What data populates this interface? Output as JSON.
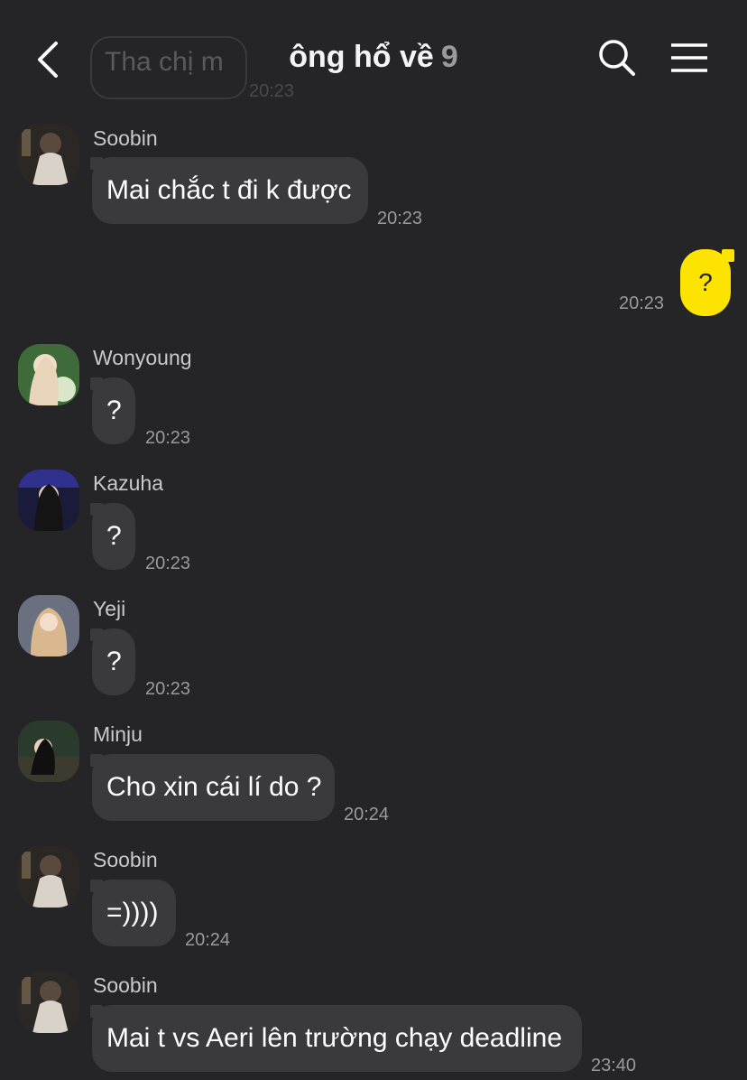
{
  "header": {
    "title": "ông hổ về",
    "count": "9",
    "icons": {
      "back": "chevron-left-icon",
      "search": "search-icon",
      "menu": "hamburger-menu-icon"
    }
  },
  "ghost_message": {
    "text": "Tha chị m",
    "time": "20:23"
  },
  "messages": [
    {
      "sender": "Soobin",
      "text": "Mai chắc t đi k được",
      "time": "20:23"
    },
    {
      "sender": "me",
      "text": "?",
      "time": "20:23"
    },
    {
      "sender": "Wonyoung",
      "text": "?",
      "time": "20:23"
    },
    {
      "sender": "Kazuha",
      "text": "?",
      "time": "20:23"
    },
    {
      "sender": "Yeji",
      "text": "?",
      "time": "20:23"
    },
    {
      "sender": "Minju",
      "text": "Cho xin cái lí do ?",
      "time": "20:24"
    },
    {
      "sender": "Soobin",
      "text": "=))))",
      "time": "20:24"
    },
    {
      "sender": "Soobin",
      "text": "Mai t vs Aeri lên trường chạy deadline",
      "time": "23:40"
    }
  ],
  "colors": {
    "background": "#252528",
    "bubble": "#3a3a3d",
    "my_bubble": "#fce300"
  }
}
